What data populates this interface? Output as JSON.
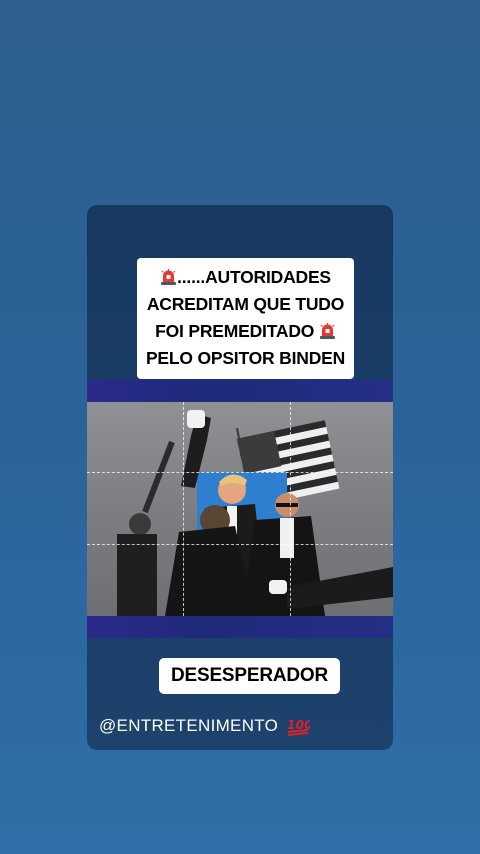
{
  "story": {
    "headline_lines": [
      "......AUTORIDADES",
      "ACREDITAM QUE TUDO",
      "FOI PREMEDITADO",
      "PELO OPSITOR BINDEN"
    ],
    "caption": "DESESPERADOR",
    "handle": "@ENTRETENIMENTO"
  },
  "icons": {
    "siren": "police-siren-emoji",
    "hundred": "hundred-points-emoji"
  },
  "colors": {
    "background": "#2f6ea8",
    "card": "#183a62",
    "band": "#262f86",
    "siren_red": "#e53935",
    "hundred_red": "#e0202a"
  }
}
